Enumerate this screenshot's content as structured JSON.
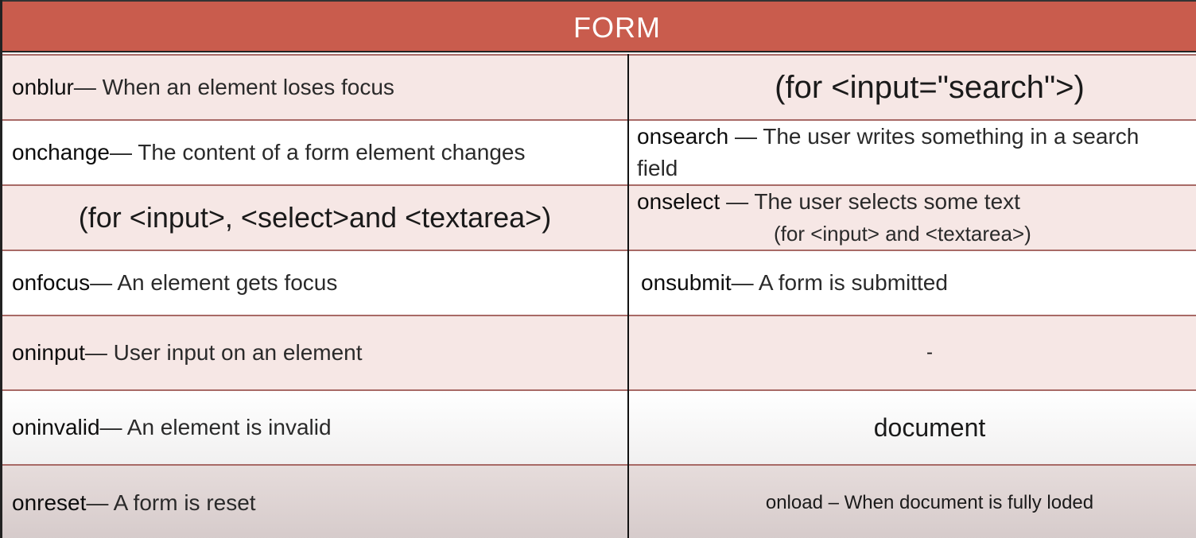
{
  "header": {
    "title": "FORM"
  },
  "left": [
    {
      "event": "onblur",
      "desc": " — When an element loses focus"
    },
    {
      "event": "onchange",
      "desc": " — The content of a form element changes"
    },
    {
      "note": "(for <input>, <select>and <textarea>)"
    },
    {
      "event": "onfocus",
      "desc": " — An element gets focus"
    },
    {
      "event": "oninput",
      "desc": " — User input on an element"
    },
    {
      "event": "oninvalid",
      "desc": " — An element is invalid"
    },
    {
      "event": "onreset",
      "desc": " — A form is reset"
    }
  ],
  "right": {
    "search_note": "(for <input=\"search\">)",
    "onsearch": {
      "event": "onsearch",
      "desc": " — The user writes something in a search",
      "desc2": "field"
    },
    "onselect": {
      "event": "onselect",
      "desc": " — The user selects some text",
      "note": "(for <input> and <textarea>)"
    },
    "onsubmit": {
      "event": "onsubmit",
      "desc": " — A form is submitted"
    },
    "dash": "-",
    "document_heading": "document",
    "onload": "onload – When document is fully loded"
  },
  "colors": {
    "header": "#c95c4d",
    "row_pink": "#f6e7e5",
    "row_border": "#a86a66"
  }
}
